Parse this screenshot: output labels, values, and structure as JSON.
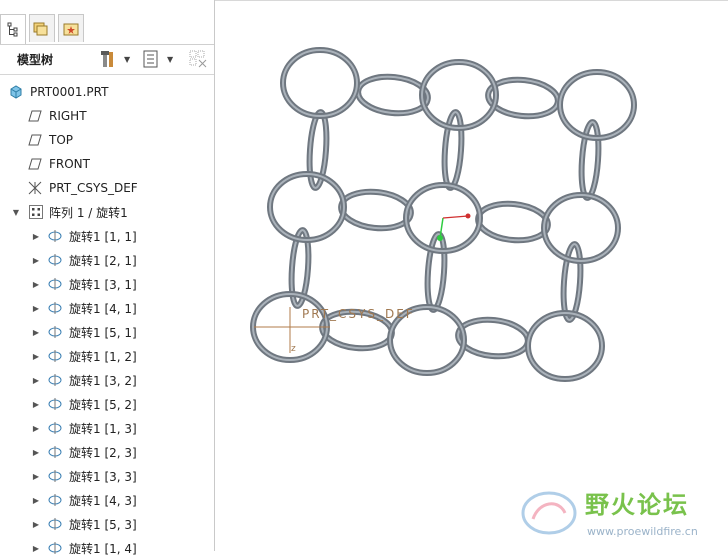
{
  "model_tree": {
    "title": "模型树",
    "root": "PRT0001.PRT",
    "datums": [
      {
        "label": "RIGHT"
      },
      {
        "label": "TOP"
      },
      {
        "label": "FRONT"
      }
    ],
    "csys": "PRT_CSYS_DEF",
    "pattern": "阵列 1 / 旋转1",
    "pattern_items": [
      {
        "label": "旋转1 [1, 1]"
      },
      {
        "label": "旋转1 [2, 1]"
      },
      {
        "label": "旋转1 [3, 1]"
      },
      {
        "label": "旋转1 [4, 1]"
      },
      {
        "label": "旋转1 [5, 1]"
      },
      {
        "label": "旋转1 [1, 2]"
      },
      {
        "label": "旋转1 [3, 2]"
      },
      {
        "label": "旋转1 [5, 2]"
      },
      {
        "label": "旋转1 [1, 3]"
      },
      {
        "label": "旋转1 [2, 3]"
      },
      {
        "label": "旋转1 [3, 3]"
      },
      {
        "label": "旋转1 [4, 3]"
      },
      {
        "label": "旋转1 [5, 3]"
      },
      {
        "label": "旋转1 [1, 4]"
      }
    ]
  },
  "viewport": {
    "csys_label": "PRT_CSYS_DEF",
    "axis_x": "x",
    "axis_y": "Y",
    "axis_z": "z",
    "ring_color": "#6f7780",
    "ring_highlight": "#aab2ba"
  },
  "watermark": {
    "title": "野火论坛",
    "url": "www.proewildfire.cn"
  },
  "colors": {
    "panel_border": "#c9c9c9",
    "watermark_green": "#79c24c"
  }
}
